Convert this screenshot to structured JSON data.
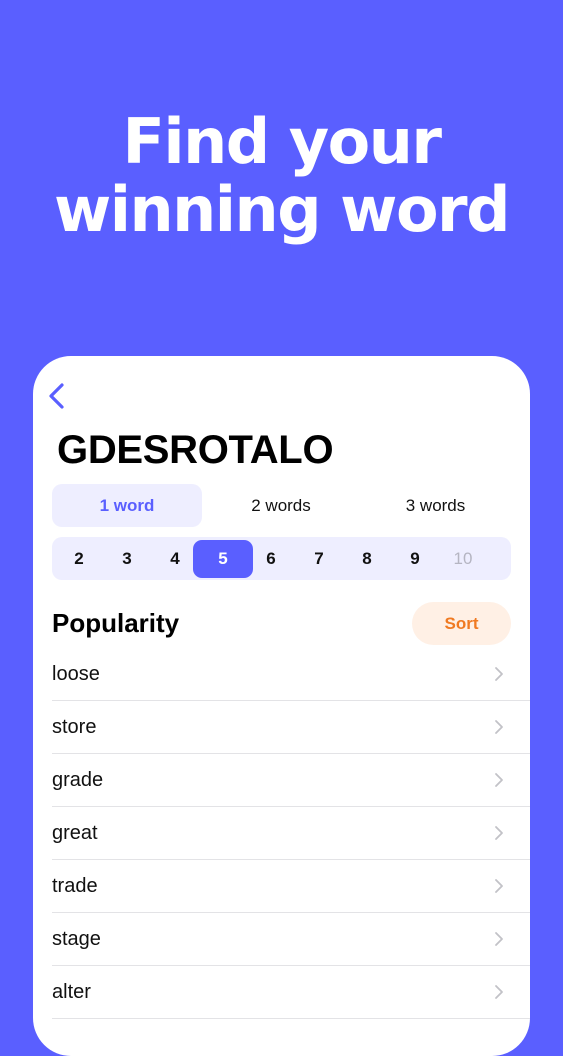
{
  "headline": {
    "line1": "Find your",
    "line2": "winning word"
  },
  "card": {
    "back_icon": "chevron-left-icon",
    "letters": "GDESROTALO",
    "word_count_tabs": [
      {
        "label": "1 word",
        "active": true
      },
      {
        "label": "2 words",
        "active": false
      },
      {
        "label": "3 words",
        "active": false
      }
    ],
    "lengths": [
      {
        "label": "2",
        "state": "normal"
      },
      {
        "label": "3",
        "state": "normal"
      },
      {
        "label": "4",
        "state": "normal"
      },
      {
        "label": "5",
        "state": "active"
      },
      {
        "label": "6",
        "state": "normal"
      },
      {
        "label": "7",
        "state": "normal"
      },
      {
        "label": "8",
        "state": "normal"
      },
      {
        "label": "9",
        "state": "normal"
      },
      {
        "label": "10",
        "state": "disabled"
      }
    ],
    "section_title": "Popularity",
    "sort_label": "Sort",
    "words": [
      "loose",
      "store",
      "grade",
      "great",
      "trade",
      "stage",
      "alter"
    ]
  },
  "colors": {
    "brand": "#5a5fff",
    "tab_active_bg": "#eeeeff",
    "sort_bg": "#fff0e5",
    "sort_text": "#f07a22"
  }
}
